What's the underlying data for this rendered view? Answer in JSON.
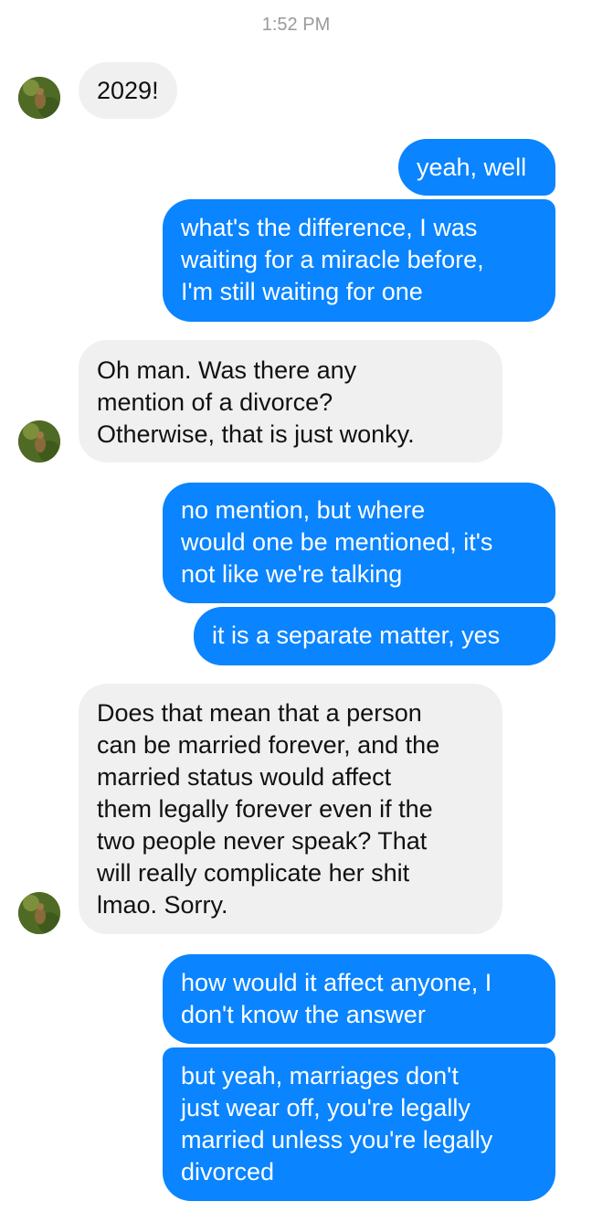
{
  "timestamp": "1:52 PM",
  "messages": [
    {
      "direction": "incoming",
      "lines": [
        "2029!"
      ]
    },
    {
      "direction": "outgoing",
      "lines": [
        "yeah, well"
      ]
    },
    {
      "direction": "outgoing",
      "lines": [
        "what's the difference, I was",
        "waiting for a miracle before,",
        "I'm still waiting for one"
      ]
    },
    {
      "direction": "incoming",
      "lines": [
        "Oh man. Was there any",
        "mention of a divorce?",
        "Otherwise, that is just wonky."
      ]
    },
    {
      "direction": "outgoing",
      "lines": [
        "no mention, but where",
        "would one be mentioned, it's",
        "not like we're talking"
      ]
    },
    {
      "direction": "outgoing",
      "lines": [
        "it is a separate matter, yes"
      ]
    },
    {
      "direction": "incoming",
      "lines": [
        "Does that mean that a person",
        "can be married forever, and the",
        "married status would affect",
        "them legally forever even if the",
        "two people never speak? That",
        "will really complicate her shit",
        "lmao. Sorry."
      ]
    },
    {
      "direction": "outgoing",
      "lines": [
        "how would it affect anyone, I",
        "don't know the answer"
      ]
    },
    {
      "direction": "outgoing",
      "lines": [
        "but yeah, marriages don't",
        "just wear off, you're legally",
        "married unless you're legally",
        "divorced"
      ]
    }
  ],
  "avatar_icon": "contact-avatar-icon",
  "colors": {
    "outgoing_bubble": "#0a84ff",
    "incoming_bubble": "#f0f0f0",
    "timestamp_text": "#9a9a9a"
  }
}
